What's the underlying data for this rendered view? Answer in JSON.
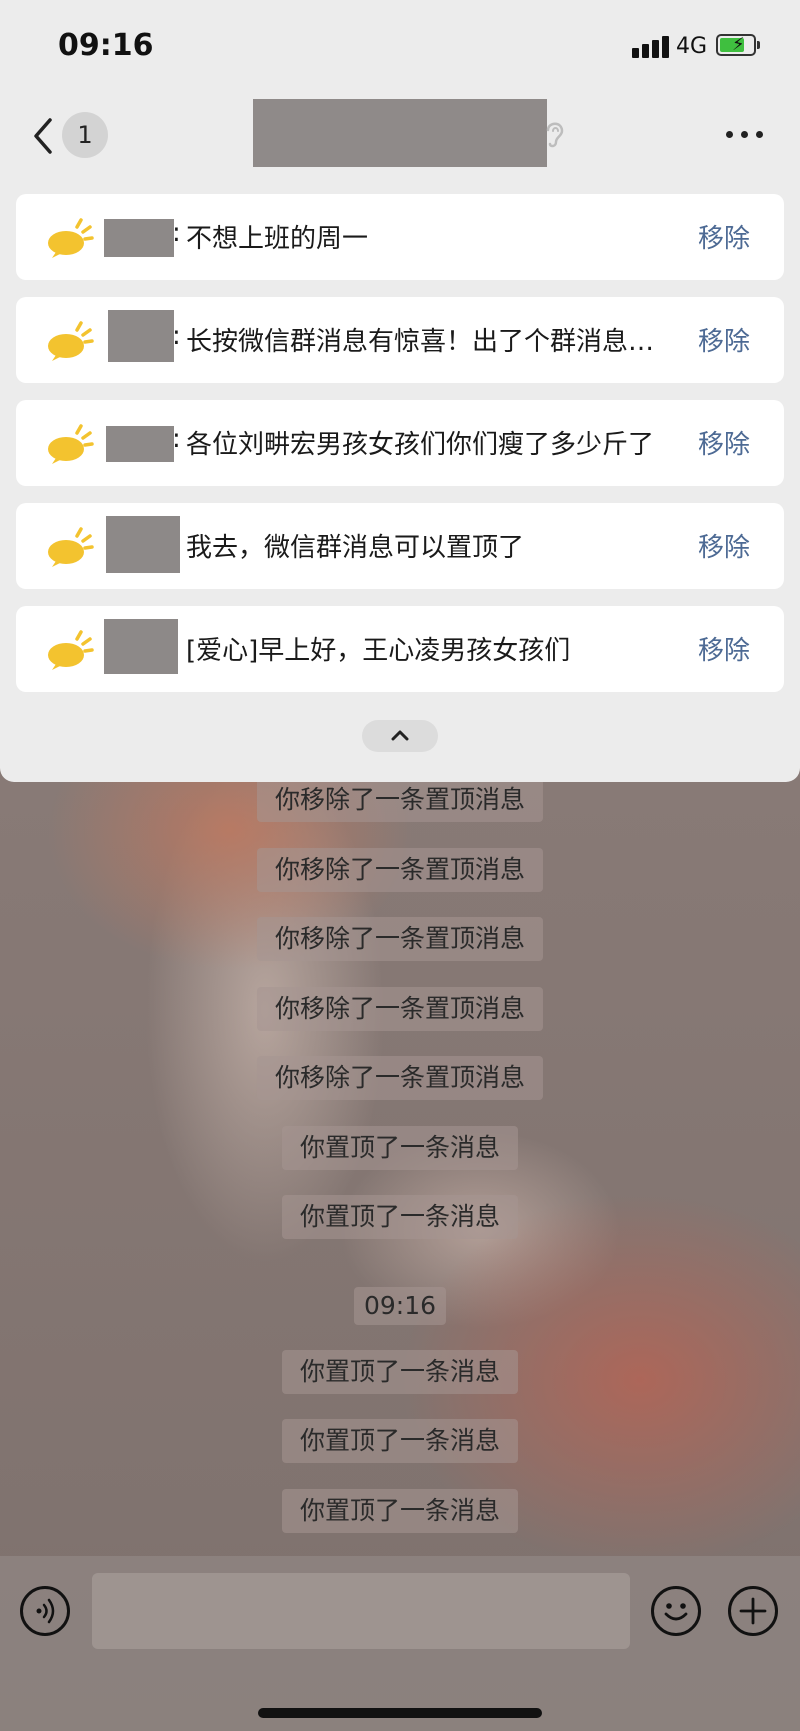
{
  "status_bar": {
    "time": "09:16",
    "network": "4G"
  },
  "nav": {
    "back_count": "1"
  },
  "pinned": [
    {
      "text": "不想上班的周一",
      "has_colon": true,
      "remove_label": "移除"
    },
    {
      "text": "长按微信群消息有惊喜！出了个群消息置顶",
      "has_colon": true,
      "remove_label": "移除"
    },
    {
      "text": "各位刘畊宏男孩女孩们你们瘦了多少斤了",
      "has_colon": true,
      "remove_label": "移除"
    },
    {
      "text": "我去，微信群消息可以置顶了",
      "has_colon": false,
      "remove_label": "移除"
    },
    {
      "text": "[爱心]早上好，王心凌男孩女孩们",
      "has_colon": false,
      "remove_label": "移除"
    }
  ],
  "messages": [
    "你移除了一条置顶消息",
    "你移除了一条置顶消息",
    "你移除了一条置顶消息",
    "你移除了一条置顶消息",
    "你移除了一条置顶消息",
    "你置顶了一条消息",
    "你置顶了一条消息",
    "09:16",
    "你置顶了一条消息",
    "你置顶了一条消息",
    "你置顶了一条消息"
  ],
  "input": {
    "placeholder": ""
  }
}
